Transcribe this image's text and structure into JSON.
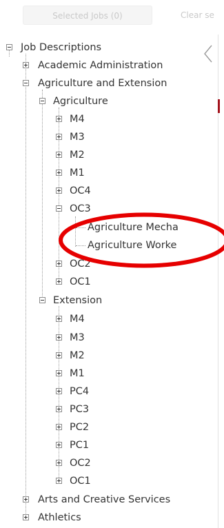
{
  "toolbar": {
    "selected_jobs_label": "Selected Jobs (0)",
    "clear_label": "Clear se"
  },
  "panel": {
    "collapse_icon": "chevron-left-icon",
    "accent_color": "#a3131c"
  },
  "annotation": {
    "color": "#e60000",
    "shape": "ellipse"
  },
  "tree": {
    "root": "Job Descriptions",
    "academic_administration": "Academic Administration",
    "agriculture_and_extension": "Agriculture and Extension",
    "agriculture": "Agriculture",
    "agri_m4": "M4",
    "agri_m3": "M3",
    "agri_m2": "M2",
    "agri_m1": "M1",
    "agri_oc4": "OC4",
    "agri_oc3": "OC3",
    "agri_oc3_job1": "Agriculture Mecha",
    "agri_oc3_job2": "Agriculture Worke",
    "agri_oc2": "OC2",
    "agri_oc1": "OC1",
    "extension": "Extension",
    "ext_m4": "M4",
    "ext_m3": "M3",
    "ext_m2": "M2",
    "ext_m1": "M1",
    "ext_pc4": "PC4",
    "ext_pc3": "PC3",
    "ext_pc2": "PC2",
    "ext_pc1": "PC1",
    "ext_oc2": "OC2",
    "ext_oc1": "OC1",
    "arts_and_creative_services": "Arts and Creative Services",
    "athletics": "Athletics"
  }
}
